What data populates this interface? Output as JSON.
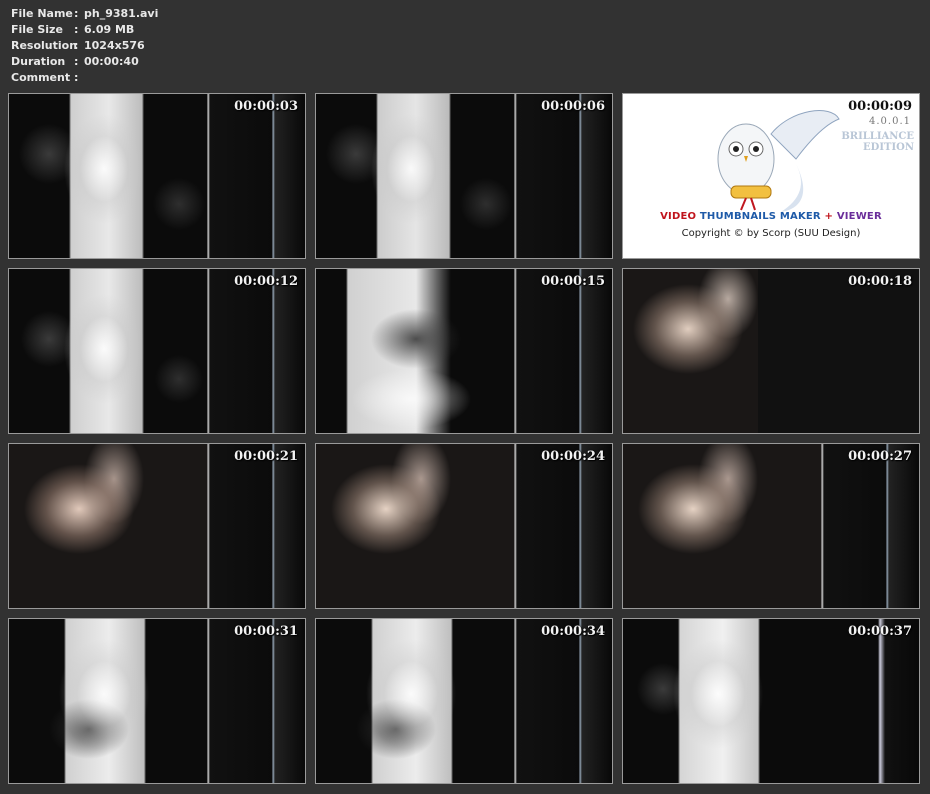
{
  "meta": {
    "rows": [
      {
        "label": "File Name",
        "sep": ":",
        "value": "ph_9381.avi"
      },
      {
        "label": "File Size",
        "sep": ":",
        "value": "6.09 MB"
      },
      {
        "label": "Resolution",
        "sep": ":",
        "value": "1024x576"
      },
      {
        "label": "Duration",
        "sep": ":",
        "value": "00:00:40"
      },
      {
        "label": "Comment",
        "sep": ":",
        "value": ""
      }
    ]
  },
  "thumbs": [
    {
      "time": "00:00:03"
    },
    {
      "time": "00:00:06"
    },
    {
      "time": "00:00:09"
    },
    {
      "time": "00:00:12"
    },
    {
      "time": "00:00:15"
    },
    {
      "time": "00:00:18"
    },
    {
      "time": "00:00:21"
    },
    {
      "time": "00:00:24"
    },
    {
      "time": "00:00:27"
    },
    {
      "time": "00:00:31"
    },
    {
      "time": "00:00:34"
    },
    {
      "time": "00:00:37"
    }
  ],
  "promo": {
    "version": "4.0.0.1",
    "edition_line1": "BRILLIANCE",
    "edition_line2": "EDITION",
    "brand_video": "VIDEO",
    "brand_thumbnails": "THUMBNAILS MAKER",
    "brand_plus": "+",
    "brand_viewer": "VIEWER",
    "copyright": "Copyright © by Scorp (SUU Design)"
  },
  "colors": {
    "background": "#323232",
    "brand_red": "#c0141c",
    "brand_blue": "#1e5aa8",
    "brand_purple": "#6a2d9a"
  }
}
